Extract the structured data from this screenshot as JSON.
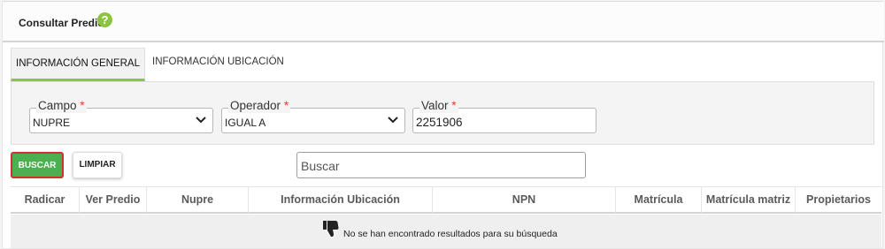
{
  "header": {
    "title": "Consultar Predio",
    "help_icon": "?"
  },
  "tabs": [
    {
      "label": "INFORMACIÓN GENERAL",
      "active": true
    },
    {
      "label": "INFORMACIÓN UBICACIÓN",
      "active": false
    }
  ],
  "filters": {
    "campo": {
      "label": "Campo",
      "required_mark": "*",
      "value": "NUPRE"
    },
    "operador": {
      "label": "Operador",
      "required_mark": "*",
      "value": "IGUAL A"
    },
    "valor": {
      "label": "Valor",
      "required_mark": "*",
      "value": "2251906"
    }
  },
  "actions": {
    "buscar_label": "BUSCAR",
    "limpiar_label": "LIMPIAR"
  },
  "search": {
    "placeholder": "Buscar"
  },
  "table": {
    "columns": [
      "Radicar",
      "Ver Predio",
      "Nupre",
      "Información Ubicación",
      "NPN",
      "Matrícula",
      "Matrícula matriz",
      "Propietarios"
    ],
    "empty_message": "No se han encontrado resultados para su búsqueda"
  },
  "colors": {
    "accent_green": "#8cc43f",
    "button_green": "#4caf50",
    "required_red": "#e53935",
    "highlight_border": "#d32f2f"
  },
  "icons": {
    "help": "question-circle-icon",
    "empty": "thumbs-down-icon",
    "dropdown": "chevron-down-icon"
  }
}
